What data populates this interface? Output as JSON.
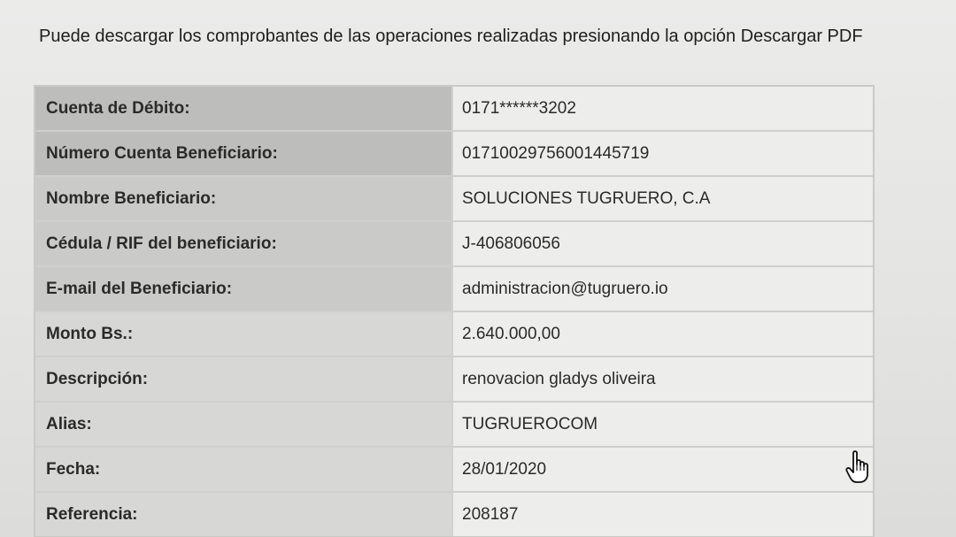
{
  "intro": {
    "text": "Puede descargar los comprobantes de las operaciones realizadas presionando la opción Descargar PDF"
  },
  "details": [
    {
      "label": "Cuenta de Débito:",
      "value": "0171******3202"
    },
    {
      "label": "Número Cuenta Beneficiario:",
      "value": "01710029756001445719"
    },
    {
      "label": "Nombre Beneficiario:",
      "value": "SOLUCIONES TUGRUERO, C.A"
    },
    {
      "label": "Cédula / RIF del beneficiario:",
      "value": "J-406806056"
    },
    {
      "label": "E-mail del Beneficiario:",
      "value": "administracion@tugruero.io"
    },
    {
      "label": "Monto Bs.:",
      "value": "2.640.000,00"
    },
    {
      "label": "Descripción:",
      "value": "renovacion gladys oliveira"
    },
    {
      "label": "Alias:",
      "value": "TUGRUEROCOM"
    },
    {
      "label": "Fecha:",
      "value": "28/01/2020"
    },
    {
      "label": "Referencia:",
      "value": "208187"
    }
  ],
  "cursor": {
    "icon": "hand-pointer-icon"
  }
}
